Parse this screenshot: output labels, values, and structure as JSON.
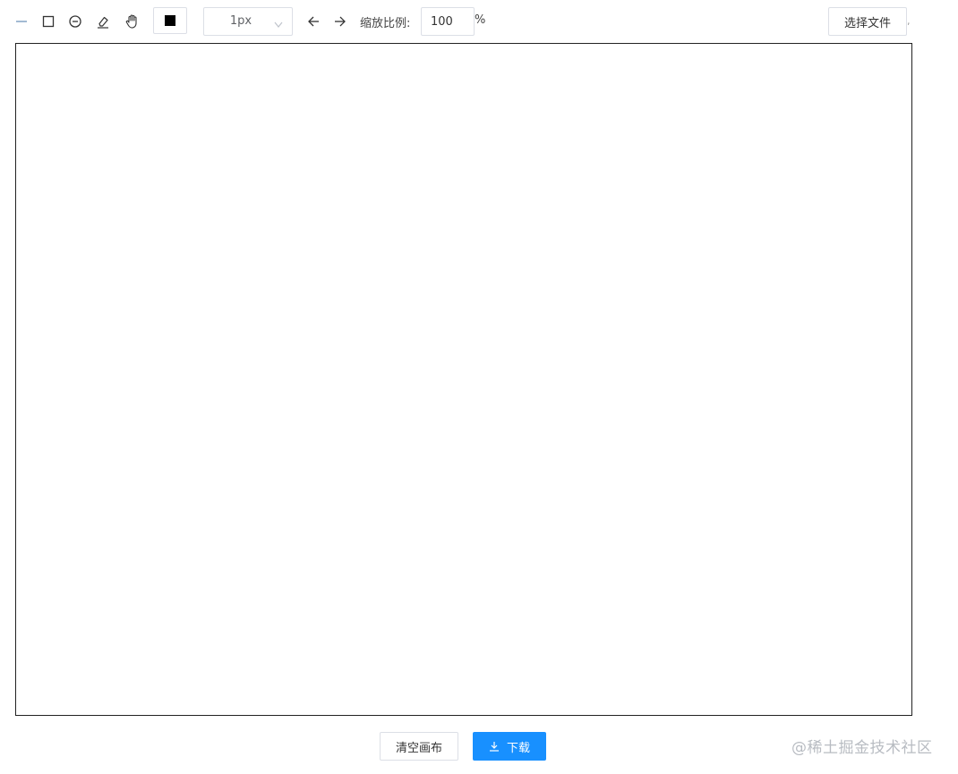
{
  "toolbar": {
    "tools": [
      {
        "name": "line",
        "icon": "line-icon"
      },
      {
        "name": "rectangle",
        "icon": "square-icon"
      },
      {
        "name": "circle",
        "icon": "circle-minus-icon"
      },
      {
        "name": "eraser",
        "icon": "eraser-icon"
      },
      {
        "name": "pan",
        "icon": "hand-icon"
      }
    ],
    "color_value": "#000000",
    "line_width": {
      "selected": "1px"
    },
    "undo_icon": "arrow-left-icon",
    "redo_icon": "arrow-right-icon",
    "zoom": {
      "label": "缩放比例:",
      "value": "100",
      "unit": "%"
    },
    "file_button_label": "选择文件",
    "file_trailing": ","
  },
  "actions": {
    "clear_label": "清空画布",
    "download_label": "下载",
    "download_icon": "download-icon"
  },
  "watermark": "@稀土掘金技术社区",
  "colors": {
    "accent": "#1890ff",
    "line_tool": "#8aa8c8",
    "border": "#dcdfe6"
  }
}
